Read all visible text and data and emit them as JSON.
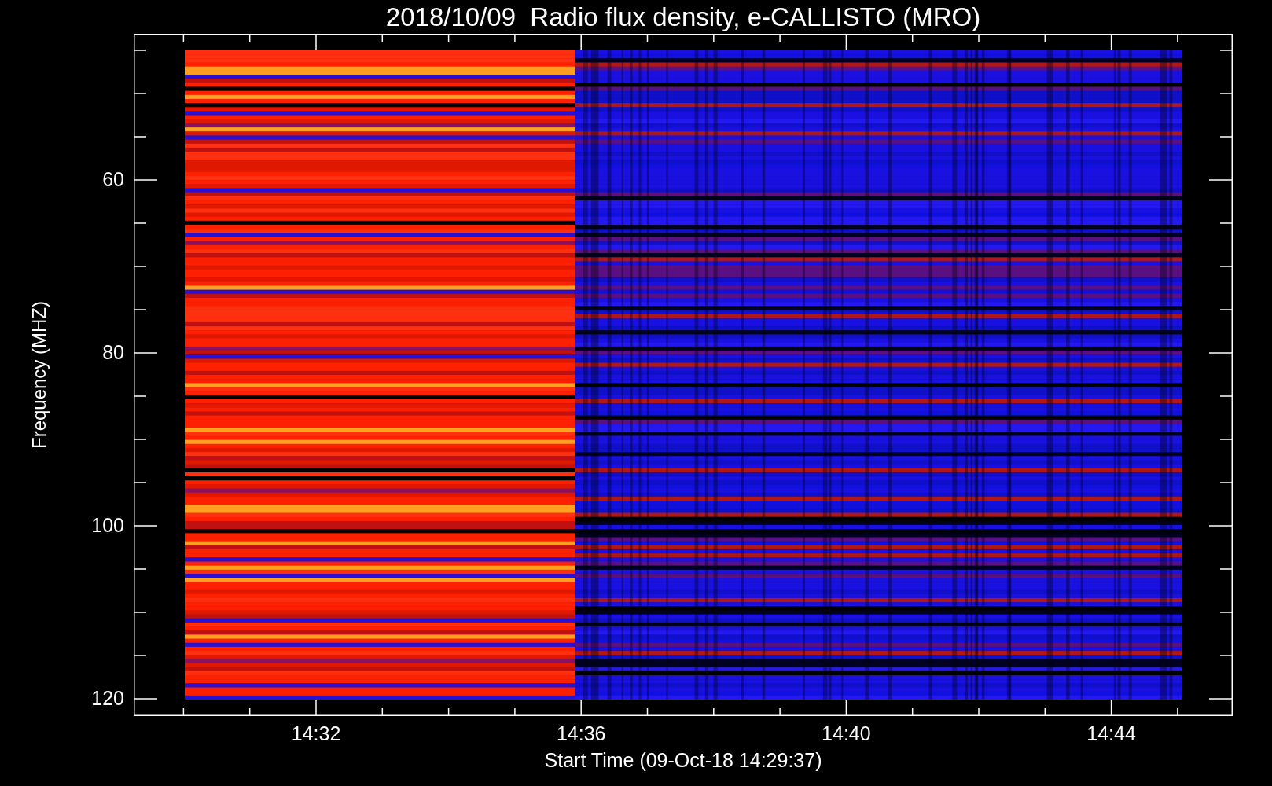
{
  "title": "2018/10/09  Radio flux density, e-CALLISTO (MRO)",
  "y_axis": {
    "label": "Frequency (MHZ)",
    "ticks": [
      "60",
      "80",
      "100",
      "120"
    ]
  },
  "x_axis": {
    "label": "Start Time (09-Oct-18 14:29:37)",
    "ticks": [
      "14:32",
      "14:36",
      "14:40",
      "14:44"
    ]
  }
}
